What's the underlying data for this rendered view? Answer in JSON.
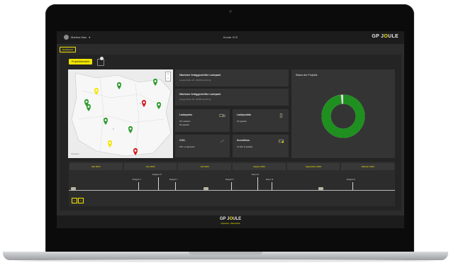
{
  "header": {
    "user_name": "Martina Mau",
    "user_chevron": "▾",
    "title": "Kunde XYZ",
    "logo_a": "GP J",
    "logo_b": "O",
    "logo_c": "ULE"
  },
  "nav": {
    "dashboard_label": "Dashboard",
    "active_tab": "Projektübersicht"
  },
  "map": {
    "label": "Kapellen",
    "zoom_in": "+",
    "zoom_out": "−",
    "pins": [
      {
        "color": "yellow"
      },
      {
        "color": "green"
      },
      {
        "color": "green"
      },
      {
        "color": "green"
      },
      {
        "color": "green"
      },
      {
        "color": "red"
      },
      {
        "color": "green"
      },
      {
        "color": "green"
      },
      {
        "color": "green"
      },
      {
        "color": "yellow"
      },
      {
        "color": "red"
      }
    ]
  },
  "cards": {
    "next1_title": "Nächster fertiggestellter Ladepark",
    "next1_sub": "Lange Reihe 24, 20099 Hamburg",
    "next2_title": "Nächster fertiggestellter Ladepark",
    "next2_sub": "Lange Reihe 24, 20099 Hamburg",
    "ladeparks_title": "Ladeparks",
    "ladeparks_l1": "35 realisiert",
    "ladeparks_l2": "65 geplant",
    "ladepunkte_title": "Ladepunkte",
    "ladepunkte_l1": "30 geplant",
    "co2_title": "CO2-",
    "co2_l1": "200 t eingespart",
    "invest_title": "Investition",
    "invest_l1": "10 Mio € getätigt"
  },
  "status": {
    "title": "Status der Projekte",
    "progress": 0.98,
    "color_done": "#1f8f1f",
    "color_rest": "#d8d8d8"
  },
  "timeline": {
    "months": [
      "Mai 2024",
      "Juni 2024",
      "Juli 2024",
      "August 2024",
      "September 2024",
      "Oktober 2024"
    ],
    "events": [
      {
        "label": "Ereignis 3"
      },
      {
        "label": "Ereignis 27"
      },
      {
        "label": "Ereignis 7"
      },
      {
        "label": "Ereignis 5"
      },
      {
        "label": "Event 21"
      },
      {
        "label": "Event 13"
      },
      {
        "label": "Ereignis 8"
      }
    ],
    "prev": "‹",
    "next": "›"
  },
  "footer": {
    "logo_a": "GP J",
    "logo_b": "O",
    "logo_c": "ULE",
    "tagline": "Impressum · Datenschutz"
  }
}
